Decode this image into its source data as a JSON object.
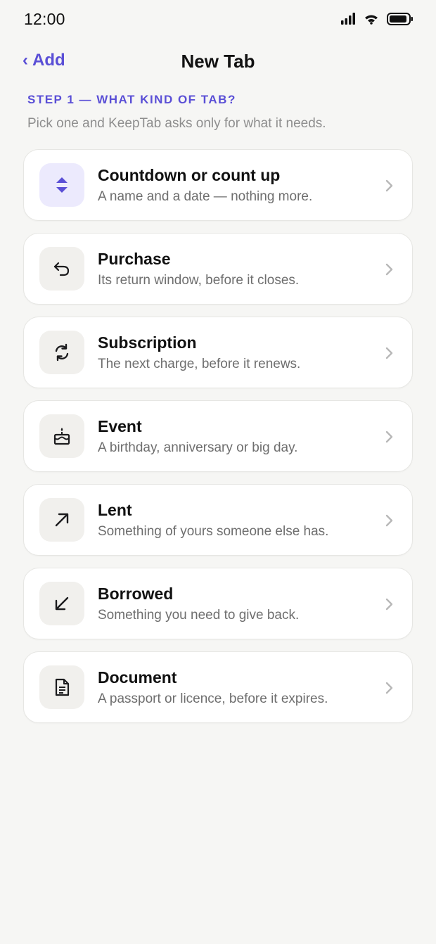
{
  "status_bar": {
    "time": "12:00"
  },
  "nav": {
    "back_label": "Add",
    "title": "New Tab"
  },
  "step": {
    "label": "STEP 1 — WHAT KIND OF TAB?",
    "hint": "Pick one and KeepTab asks only for what it needs."
  },
  "colors": {
    "accent": "#5a4fd6",
    "background": "#f6f6f4",
    "card": "#ffffff"
  },
  "options": [
    {
      "title": "Countdown or count up",
      "description": "A name and a date — nothing more.",
      "icon": "up-down-arrows-icon"
    },
    {
      "title": "Purchase",
      "description": "Its return window, before it closes.",
      "icon": "return-arrow-icon"
    },
    {
      "title": "Subscription",
      "description": "The next charge, before it renews.",
      "icon": "refresh-icon"
    },
    {
      "title": "Event",
      "description": "A birthday, anniversary or big day.",
      "icon": "cake-icon"
    },
    {
      "title": "Lent",
      "description": "Something of yours someone else has.",
      "icon": "arrow-up-right-icon"
    },
    {
      "title": "Borrowed",
      "description": "Something you need to give back.",
      "icon": "arrow-down-left-icon"
    },
    {
      "title": "Document",
      "description": "A passport or licence, before it expires.",
      "icon": "document-icon"
    }
  ]
}
